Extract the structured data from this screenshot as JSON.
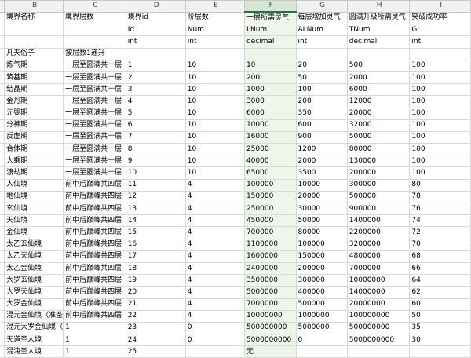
{
  "columns": [
    "B",
    "C",
    "D",
    "E",
    "F",
    "G",
    "H",
    "I"
  ],
  "selected_column": "F",
  "rows": [
    [
      "境界名称",
      "境界层数",
      "境界id",
      "阶层数",
      "一层所需灵气",
      "每层增加灵气",
      "圆满升级所需灵气",
      "突破成功率"
    ],
    [
      "",
      "",
      "Id",
      "Num",
      "LNum",
      "ALNum",
      "TNum",
      "GL"
    ],
    [
      "",
      "",
      "int",
      "int",
      "decimal",
      "int",
      "decimal",
      "int"
    ],
    [
      "凡夫俗子",
      "按层数1递升",
      "",
      "",
      "",
      "",
      "",
      ""
    ],
    [
      "炼气期",
      "一层至圆满共十层",
      "1",
      "10",
      "10",
      "20",
      "500",
      "100"
    ],
    [
      "筑基期",
      "一层至圆满共十层",
      "2",
      "10",
      "200",
      "50",
      "2000",
      "100"
    ],
    [
      "结晶期",
      "一层至圆满共十层",
      "3",
      "10",
      "1000",
      "100",
      "6000",
      "100"
    ],
    [
      "金丹期",
      "一层至圆满共十层",
      "4",
      "10",
      "3000",
      "200",
      "12000",
      "100"
    ],
    [
      "元婴期",
      "一层至圆满共十层",
      "5",
      "10",
      "6000",
      "350",
      "20000",
      "100"
    ],
    [
      "分神期",
      "一层至圆满共十层",
      "6",
      "10",
      "10000",
      "600",
      "32000",
      "100"
    ],
    [
      "反虚期",
      "一层至圆满共十层",
      "7",
      "10",
      "16000",
      "900",
      "50000",
      "100"
    ],
    [
      "合体期",
      "一层至圆满共十层",
      "8",
      "10",
      "25000",
      "1200",
      "80000",
      "100"
    ],
    [
      "大乘期",
      "一层至圆满共十层",
      "9",
      "10",
      "40000",
      "2000",
      "130000",
      "100"
    ],
    [
      "渡劫期",
      "一层至圆满共十层",
      "10",
      "10",
      "65000",
      "3500",
      "200000",
      "100"
    ],
    [
      "人仙境",
      "前中后巅峰共四层",
      "11",
      "4",
      "100000",
      "10000",
      "300000",
      "80"
    ],
    [
      "地仙境",
      "前中后巅峰共四层",
      "12",
      "4",
      "150000",
      "20000",
      "500000",
      "78"
    ],
    [
      "玄仙境",
      "前中后巅峰共四层",
      "13",
      "4",
      "250000",
      "30000",
      "900000",
      "76"
    ],
    [
      "天仙境",
      "前中后巅峰共四层",
      "14",
      "4",
      "450000",
      "50000",
      "1400000",
      "74"
    ],
    [
      "金仙境",
      "前中后巅峰共四层",
      "15",
      "4",
      "700000",
      "80000",
      "2200000",
      "72"
    ],
    [
      "太乙玄仙境",
      "前中后巅峰共四层",
      "16",
      "4",
      "1100000",
      "100000",
      "3200000",
      "70"
    ],
    [
      "太乙天仙境",
      "前中后巅峰共四层",
      "17",
      "4",
      "1600000",
      "150000",
      "4800000",
      "68"
    ],
    [
      "太乙金仙境",
      "前中后巅峰共四层",
      "18",
      "4",
      "2400000",
      "200000",
      "7000000",
      "66"
    ],
    [
      "大罗玄仙境",
      "前中后巅峰共四层",
      "19",
      "4",
      "3500000",
      "300000",
      "10000000",
      "64"
    ],
    [
      "大罗天仙境",
      "前中后巅峰共四层",
      "20",
      "4",
      "5000000",
      "400000",
      "14000000",
      "62"
    ],
    [
      "大罗金仙境",
      "前中后巅峰共四层",
      "21",
      "4",
      "7000000",
      "500000",
      "20000000",
      "60"
    ],
    [
      "混元金仙境（准圣",
      "前中后巅峰共四层",
      "22",
      "4",
      "10000000",
      "1000000",
      "100000000",
      "50"
    ],
    [
      "混元大罗金仙境（",
      "1",
      "23",
      "0",
      "500000000",
      "5000000",
      "500000000",
      "35"
    ],
    [
      "天道圣人境",
      "1",
      "24",
      "0",
      "5000000000",
      "0",
      "5000000000",
      "30"
    ],
    [
      "混沌圣人境",
      "1",
      "25",
      "",
      "无",
      "",
      "",
      ""
    ]
  ]
}
